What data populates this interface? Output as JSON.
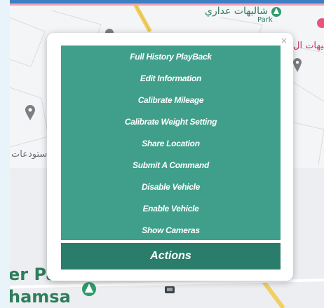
{
  "map": {
    "labels": {
      "chalet_arabic": "شاليهات عداري",
      "park_small": "Park",
      "chalet_arabic_right": "شاليهات ال",
      "warehouses_arabic": "ستودعات",
      "park_big": "er Park",
      "khamsa": "hamsa"
    }
  },
  "popup": {
    "close_label": "×",
    "menu_items": [
      "Full History PlayBack",
      "Edit Information",
      "Calibrate Mileage",
      "Calibrate Weight Setting",
      "Share Location",
      "Submit A Command",
      "Disable Vehicle",
      "Enable Vehicle",
      "Show Cameras"
    ],
    "actions_label": "Actions"
  },
  "colors": {
    "menu_bg": "#3f9f8a",
    "actions_bg": "#2b7d6b",
    "park_green": "#2e9d6b",
    "road_yellow": "#f1cf63"
  }
}
